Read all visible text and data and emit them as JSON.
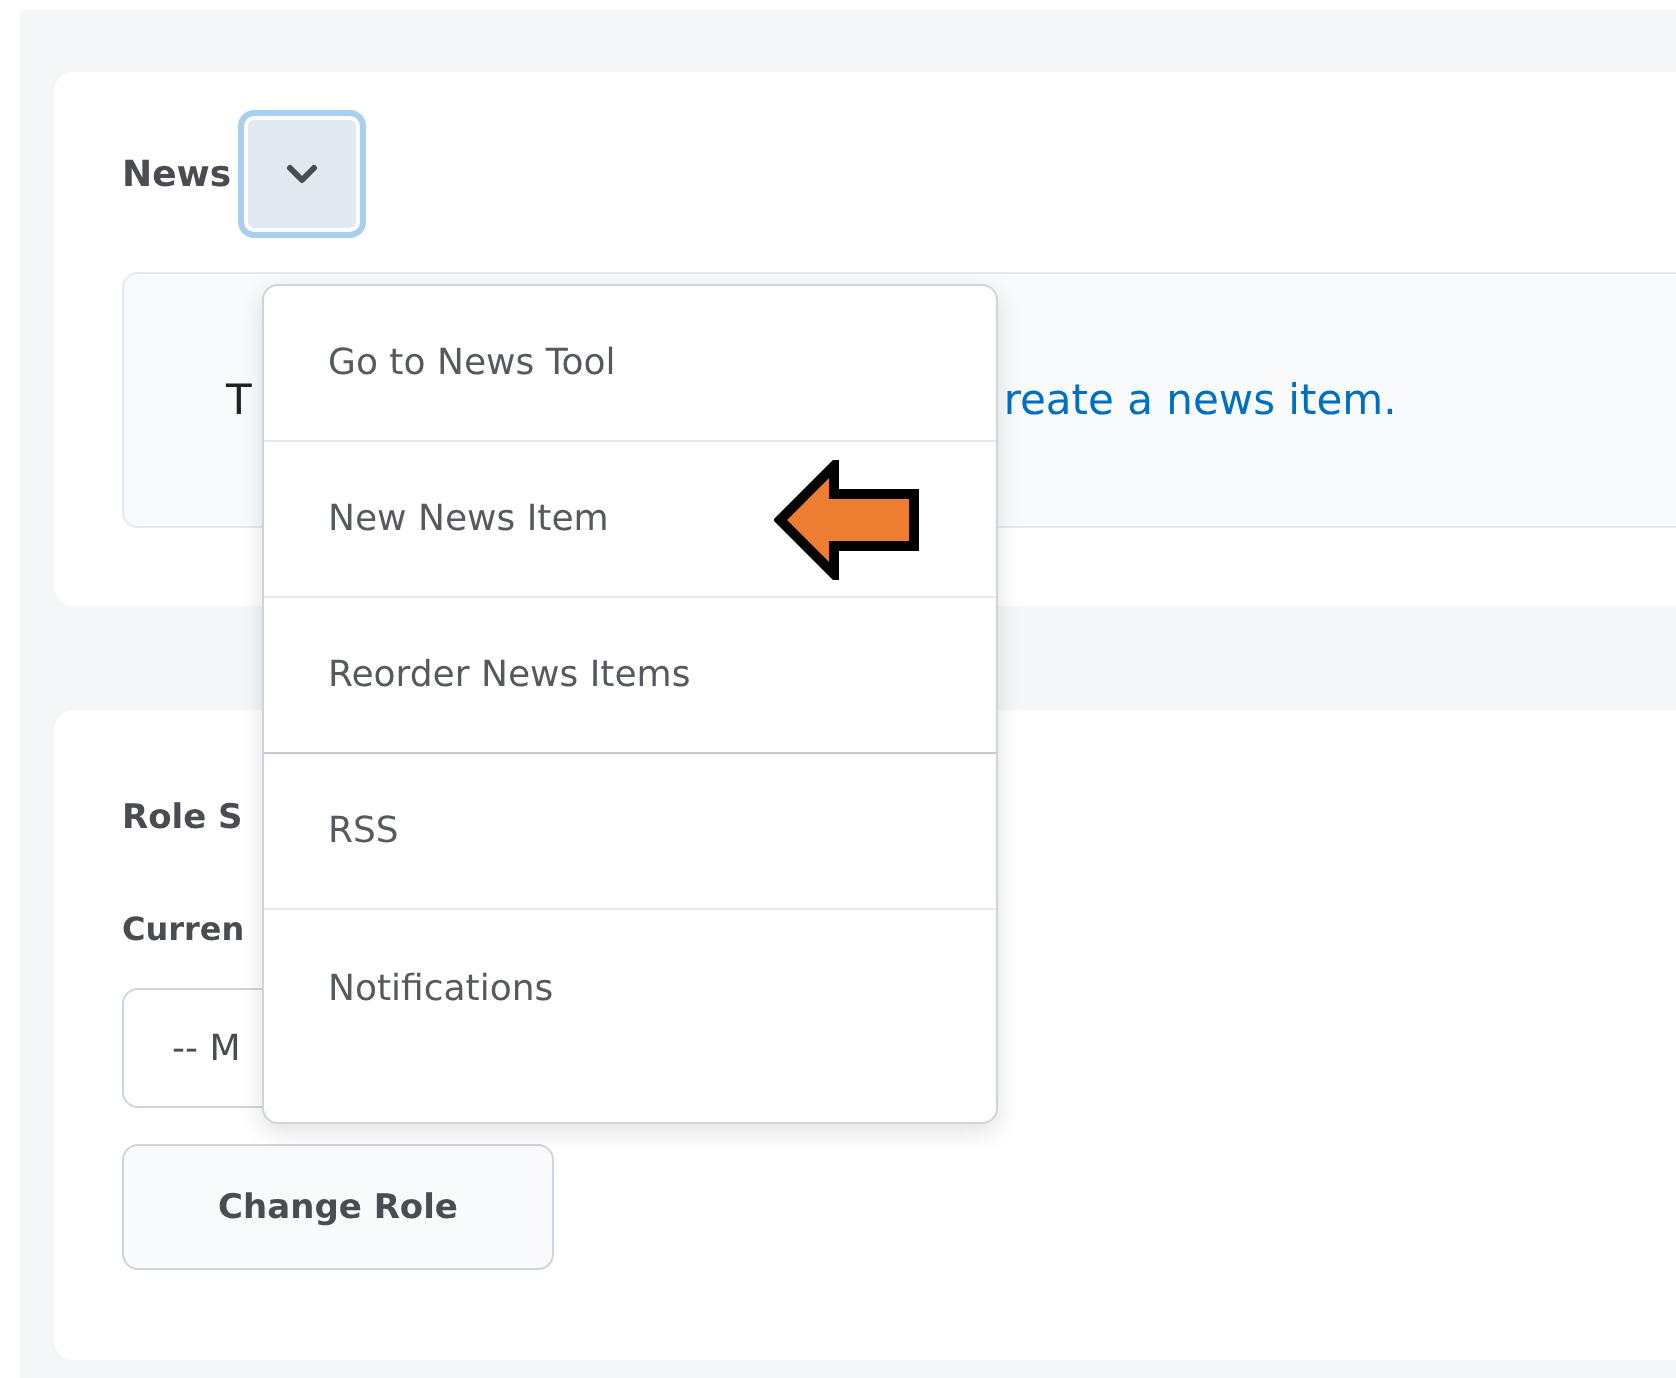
{
  "news_widget": {
    "title": "News",
    "menu_button": {
      "expanded": true
    },
    "message": {
      "text": "T",
      "link": "reate a news item."
    },
    "menu": {
      "items": [
        {
          "label": "Go to News Tool"
        },
        {
          "label": "New News Item",
          "annotated": true
        },
        {
          "label": "Reorder News Items"
        },
        {
          "label": "RSS"
        },
        {
          "label": "Notifications"
        }
      ]
    }
  },
  "role_switch": {
    "title": "Role S",
    "label": "Curren",
    "select": {
      "value": "-- M"
    },
    "button": "Change Role"
  }
}
